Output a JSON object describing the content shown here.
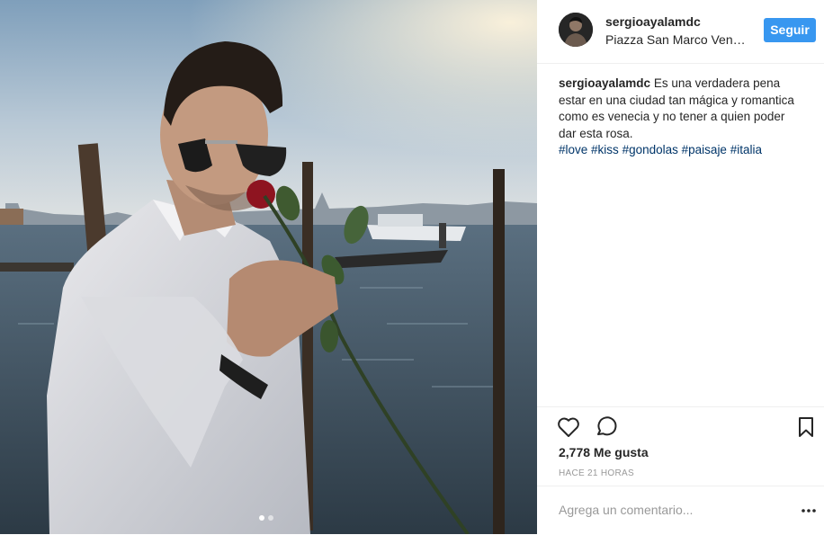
{
  "post": {
    "username": "sergioayalamdc",
    "location": "Piazza San Marco Venecia",
    "follow_label": "Seguir",
    "caption_lines": [
      "Es una verdadera pena",
      "estar en una ciudad tan mágica y romantica",
      "como es venecia y no tener a quien poder",
      "dar esta rosa."
    ],
    "hashtags": [
      "#love",
      "#kiss",
      "#gondolas",
      "#paisaje",
      "#italia"
    ],
    "likes": "2,778 Me gusta",
    "time_ago": "HACE 21 HORAS",
    "comment_placeholder": "Agrega un comentario...",
    "carousel": {
      "count": 2,
      "active": 1
    }
  },
  "icons": {
    "like": "heart-icon",
    "comment": "comment-bubble-icon",
    "save": "bookmark-icon",
    "more": "more-dots-icon"
  },
  "colors": {
    "follow_button": "#3897f0",
    "hashtag": "#003569",
    "meta_text": "#999999"
  }
}
